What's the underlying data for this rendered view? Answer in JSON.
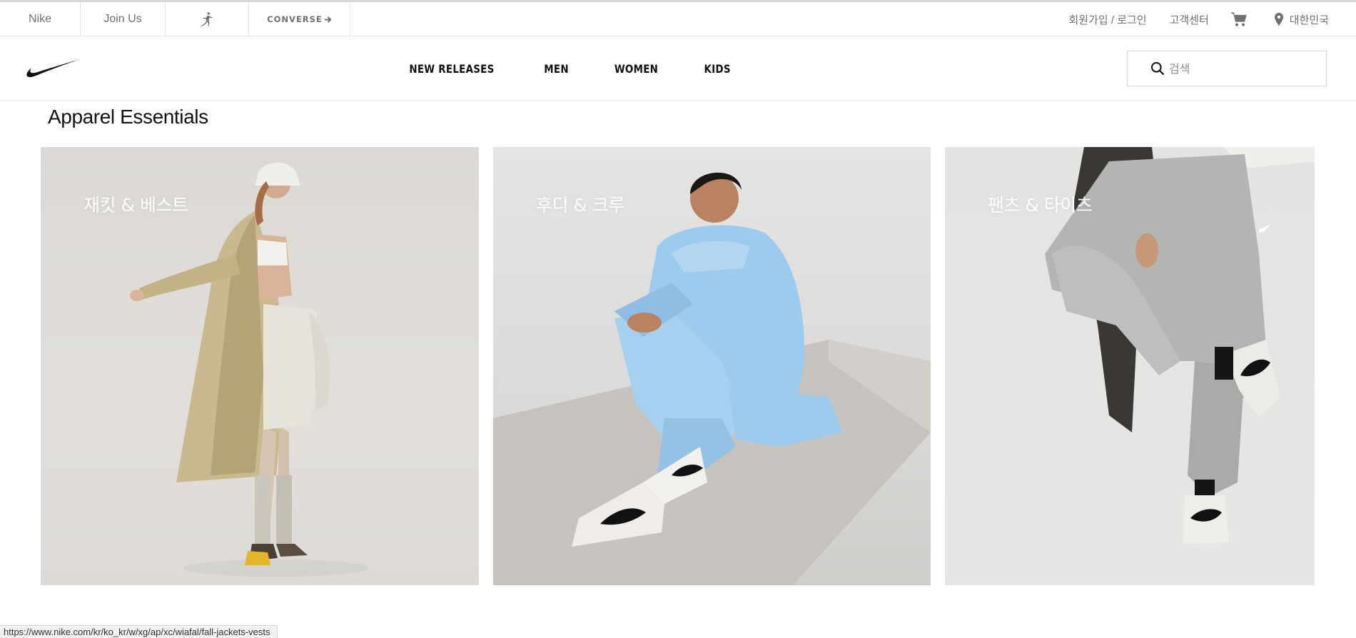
{
  "utility_bar": {
    "brand_tabs": [
      "Nike",
      "Join Us"
    ],
    "jordan_icon": "jordan-jumpman-icon",
    "converse_label": "CONVERSE",
    "login_label": "회원가입 / 로그인",
    "customer_service_label": "고객센터",
    "cart_icon": "cart-icon",
    "region_label": "대한민국",
    "region_icon": "location-pin-icon"
  },
  "main_nav": {
    "logo_icon": "nike-swoosh-icon",
    "links": [
      "NEW RELEASES",
      "MEN",
      "WOMEN",
      "KIDS"
    ],
    "search_icon": "search-icon",
    "search_placeholder": "검색",
    "search_value": ""
  },
  "section": {
    "title": "Apparel Essentials",
    "cards": [
      {
        "label": "재킷 & 베스트"
      },
      {
        "label": "후디 & 크루"
      },
      {
        "label": "팬츠 & 타이츠"
      }
    ]
  },
  "status_bar": {
    "url": "https://www.nike.com/kr/ko_kr/w/xg/ap/xc/wiafal/fall-jackets-vests"
  },
  "colors": {
    "text_primary": "#111111",
    "text_secondary": "#707072",
    "divider": "#e5e5e5",
    "card_label": "#ffffff"
  }
}
